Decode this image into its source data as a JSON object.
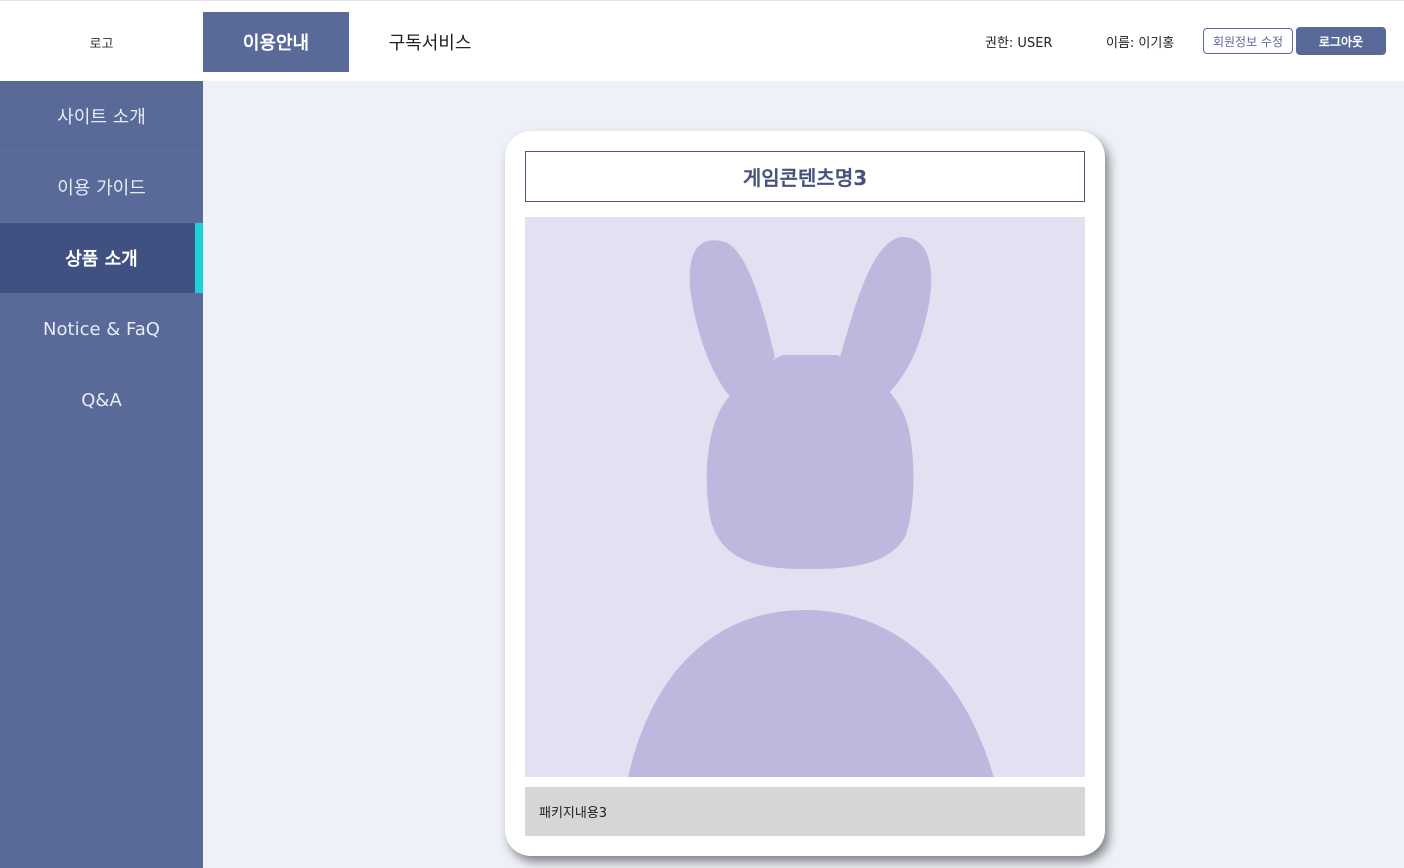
{
  "header": {
    "logo": "로고",
    "nav": [
      {
        "label": "이용안내",
        "active": true
      },
      {
        "label": "구독서비스",
        "active": false
      }
    ],
    "role": "권한: USER",
    "name": "이름: 이기홍",
    "edit_button": "회원정보 수정",
    "logout_button": "로그아웃"
  },
  "sidebar": {
    "items": [
      {
        "label": "사이트 소개"
      },
      {
        "label": "이용 가이드"
      },
      {
        "label": "상품 소개",
        "active": true
      },
      {
        "label": "Notice & FaQ"
      },
      {
        "label": "Q&A"
      }
    ]
  },
  "card": {
    "title": "게임콘텐츠명3",
    "image_icon": "placeholder-rabbit-icon",
    "description": "패키지내용3"
  },
  "colors": {
    "accent": "#596a99",
    "active_sidebar": "#3f5081",
    "active_indicator": "#1fd2d8",
    "background": "#eef1f7"
  }
}
